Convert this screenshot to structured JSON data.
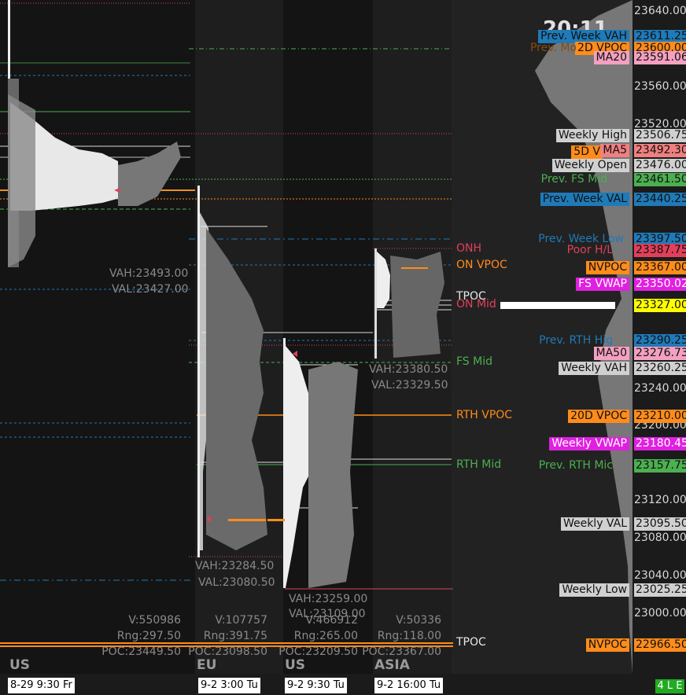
{
  "colors": {
    "bg": "#1b1b1b",
    "panel_dark": "#141414",
    "panel_mid": "#222222",
    "orange": "#ff8c1a",
    "blue": "#1f7ab8",
    "green": "#4caf50",
    "pink": "#f080a0",
    "magenta": "#e020e0",
    "red": "#e0405a",
    "lightgray": "#d0d0d0",
    "yellow": "#ffff00"
  },
  "clock": "20:11",
  "sessions": [
    {
      "name": "US",
      "time": "8-29  9:30 Fr",
      "vah": "VAH:23493.00",
      "val": "VAL:23427.00",
      "volume": "V:550986",
      "range": "Rng:297.50",
      "poc": "POC:23449.50"
    },
    {
      "name": "EU",
      "time": "9-2  3:00 Tu",
      "vah": "VAH:23284.50",
      "val": "VAL:23080.50",
      "volume": "V:107757",
      "range": "Rng:391.75",
      "poc": "POC:23098.50"
    },
    {
      "name": "US",
      "time": "9-2  9:30 Tu",
      "vah": "VAH:23259.00",
      "val": "VAL:23109.00",
      "volume": "V:466912",
      "range": "Rng:265.00",
      "poc": "POC:23209.50"
    },
    {
      "name": "ASIA",
      "time": "9-2  16:00 Tu",
      "vah": "VAH:23380.50",
      "val": "VAL:23329.50",
      "volume": "V:50336",
      "range": "Rng:118.00",
      "poc": "POC:23367.00"
    }
  ],
  "mid_labels": {
    "onh": "ONH",
    "on_vpoc": "ON VPOC",
    "tpoc": "TPOC",
    "on_mid": "ON Mid",
    "fs_mid": "FS Mid",
    "rth_vpoc": "RTH VPOC",
    "rth_mid": "RTH Mid",
    "tpoc_bottom": "TPOC"
  },
  "axis_ticks": [
    "23640.00",
    "23560.00",
    "23520.00",
    "23240.00",
    "23200.00",
    "23120.00",
    "23080.00",
    "23040.00",
    "23000.00"
  ],
  "price_tags": [
    {
      "label": "Prev. Week VAH",
      "value": "23611.25",
      "color": "#1f7ab8",
      "text": "#111"
    },
    {
      "label": "2D VPOC",
      "value": "23600.00",
      "color": "#ff8c1a",
      "text": "#111"
    },
    {
      "label": "Prev. Mo",
      "value": "",
      "color": "#8a4a10",
      "text": "#111"
    },
    {
      "label": "MA20",
      "value": "23591.06",
      "color": "#f4a0c0",
      "text": "#111"
    },
    {
      "label": "Weekly High",
      "value": "23506.75",
      "color": "#d0d0d0",
      "text": "#111"
    },
    {
      "label": "5D V",
      "value": "",
      "color": "#ff8c1a",
      "text": "#111"
    },
    {
      "label": "MA5",
      "value": "23492.30",
      "color": "#f08080",
      "text": "#111"
    },
    {
      "label": "Weekly Open",
      "value": "23476.00",
      "color": "#d0d0d0",
      "text": "#111"
    },
    {
      "label": "Prev. FS Mid",
      "value": "23461.50",
      "color": "#4caf50",
      "text": "#111"
    },
    {
      "label": "Prev. Week VAL",
      "value": "23440.25",
      "color": "#1f7ab8",
      "text": "#111"
    },
    {
      "label": "Prev. Week Low",
      "value": "23397.50",
      "color": "#1f7ab8",
      "text": "#111"
    },
    {
      "label": "Poor H/L",
      "value": "23387.75",
      "color": "#e0405a",
      "text": "#111"
    },
    {
      "label": "NVPOC",
      "value": "23367.00",
      "color": "#ff8c1a",
      "text": "#111"
    },
    {
      "label": "FS VWAP",
      "value": "23350.02",
      "color": "#e020e0",
      "text": "#fff"
    },
    {
      "label": "",
      "value": "23327.00",
      "color": "#ffff00",
      "text": "#111"
    },
    {
      "label": "Prev. RTH Hig",
      "value": "23290.25",
      "color": "#1f7ab8",
      "text": "#111"
    },
    {
      "label": "MA50",
      "value": "23276.73",
      "color": "#f4a0c0",
      "text": "#111"
    },
    {
      "label": "Weekly VAH",
      "value": "23260.25",
      "color": "#d0d0d0",
      "text": "#111"
    },
    {
      "label": "20D VPOC",
      "value": "23210.00",
      "color": "#ff8c1a",
      "text": "#111"
    },
    {
      "label": "Weekly VWAP",
      "value": "23180.45",
      "color": "#e020e0",
      "text": "#fff"
    },
    {
      "label": "Prev. RTH Mic",
      "value": "23157.75",
      "color": "#4caf50",
      "text": "#111"
    },
    {
      "label": "Weekly VAL",
      "value": "23095.50",
      "color": "#d0d0d0",
      "text": "#111"
    },
    {
      "label": "Weekly Low",
      "value": "23025.25",
      "color": "#d0d0d0",
      "text": "#111"
    },
    {
      "label": "NVPOC",
      "value": "22966.50",
      "color": "#ff8c1a",
      "text": "#111"
    }
  ],
  "status_badge": "4 L E"
}
